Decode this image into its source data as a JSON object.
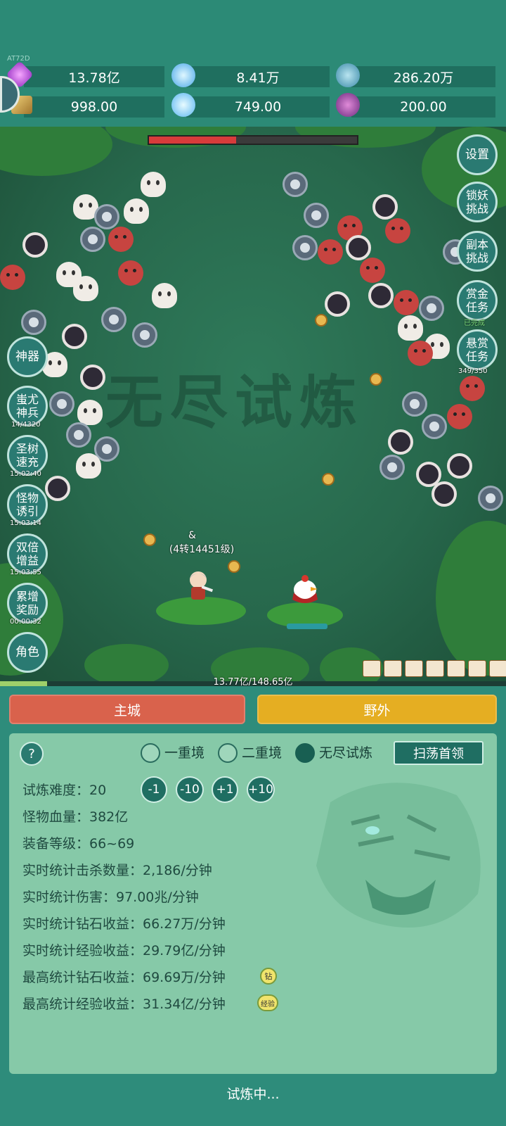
{
  "header": {
    "small_text": "AT72D",
    "resources": [
      {
        "icon": "purple-gem-icon",
        "value": "13.78亿"
      },
      {
        "icon": "blue-crystal-icon",
        "value": "8.41万"
      },
      {
        "icon": "planet-orb-icon",
        "value": "286.20万"
      },
      {
        "icon": "wing-icon",
        "value": "998.00"
      },
      {
        "icon": "ice-shard-icon",
        "value": "749.00"
      },
      {
        "icon": "purple-pot-icon",
        "value": "200.00"
      }
    ]
  },
  "field": {
    "watermark": "无尽试炼",
    "boss_hp_percent": 42,
    "right_buttons": [
      {
        "label": "设置",
        "sub": ""
      },
      {
        "label": "锁妖\n挑战",
        "sub": ""
      },
      {
        "label": "副本\n挑战",
        "sub": ""
      },
      {
        "label": "赏金\n任务",
        "sub": "已完成"
      },
      {
        "label": "悬赏\n任务",
        "sub": "349/350"
      }
    ],
    "left_buttons": [
      {
        "label": "神器",
        "sub": ""
      },
      {
        "label": "蚩尤\n神兵",
        "sub": "14/4320"
      },
      {
        "label": "圣树\n速充",
        "sub": "15:02:40"
      },
      {
        "label": "怪物\n诱引",
        "sub": "15:03:14"
      },
      {
        "label": "双倍\n增益",
        "sub": "15:03:55"
      },
      {
        "label": "累增\n奖励",
        "sub": "00:00:32"
      },
      {
        "label": "角色",
        "sub": ""
      }
    ],
    "player_name": "&",
    "player_level": "(4转14451级)",
    "exp_text": "13.77亿/148.65亿",
    "exp_fraction": 0.093
  },
  "tabs": {
    "main_city": "主城",
    "wild": "野外"
  },
  "panel": {
    "help": "?",
    "modes": [
      {
        "label": "一重境",
        "selected": false
      },
      {
        "label": "二重境",
        "selected": false
      },
      {
        "label": "无尽试炼",
        "selected": true
      }
    ],
    "sweep_button": "扫荡首领",
    "difficulty_label": "试炼难度：",
    "difficulty_value": "20",
    "diff_buttons": [
      "-1",
      "-10",
      "+1",
      "+10"
    ],
    "stats": [
      "怪物血量：382亿",
      "装备等级：66~69",
      "实时统计击杀数量：2,186/分钟",
      "实时统计伤害：97.00兆/分钟",
      "实时统计钻石收益：66.27万/分钟",
      "实时统计经验收益：29.79亿/分钟",
      "最高统计钻石收益：69.69万/分钟",
      "最高统计经验收益：31.34亿/分钟"
    ],
    "badge_diamond": "钻",
    "badge_exp": "经验",
    "status": "试炼中..."
  },
  "colors": {
    "main_city": "#d9624c",
    "wild": "#e5ae22",
    "accent": "#1f6e62"
  }
}
